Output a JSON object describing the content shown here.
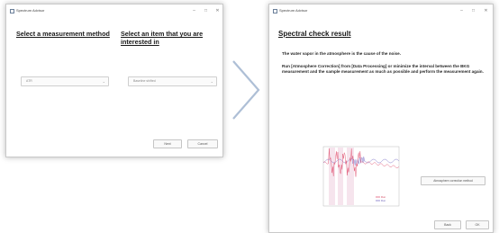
{
  "arrow_color": "#aebfd6",
  "method_dialog": {
    "title": "Spectrum Advisor",
    "controls": [
      "–",
      "□",
      "✕"
    ],
    "heading_method": "Select a measurement method",
    "heading_item": "Select an item that you are interested in",
    "method_value": "ATR",
    "item_value": "Baseline shifted",
    "next_button": "Next",
    "cancel_button": "Cancel"
  },
  "result_dialog": {
    "title": "Spectrum Advisor",
    "controls": [
      "–",
      "□",
      "✕"
    ],
    "heading": "Spectral check result",
    "cause_text": "The water vapor in the atmosphere is the cause of the noise.",
    "advice_text": "Run [Atmosphere Correction] from [Data Processing] or minimize the interval between the BKG measurement and the sample measurement as much as possible and perform the measurement again.",
    "correction_button": "Atmosphere correction method",
    "back_button": "Back",
    "ok_button": "OK"
  },
  "chart_data": {
    "type": "line",
    "title": "",
    "xlabel": "",
    "ylabel": "",
    "series": [
      {
        "color": "#e25a78",
        "description_hint": "spectrum with water vapor noise"
      },
      {
        "color": "#7e74c8",
        "description_hint": "reference spectrum"
      }
    ],
    "legend_labels": [
      "Run",
      "Run"
    ]
  }
}
